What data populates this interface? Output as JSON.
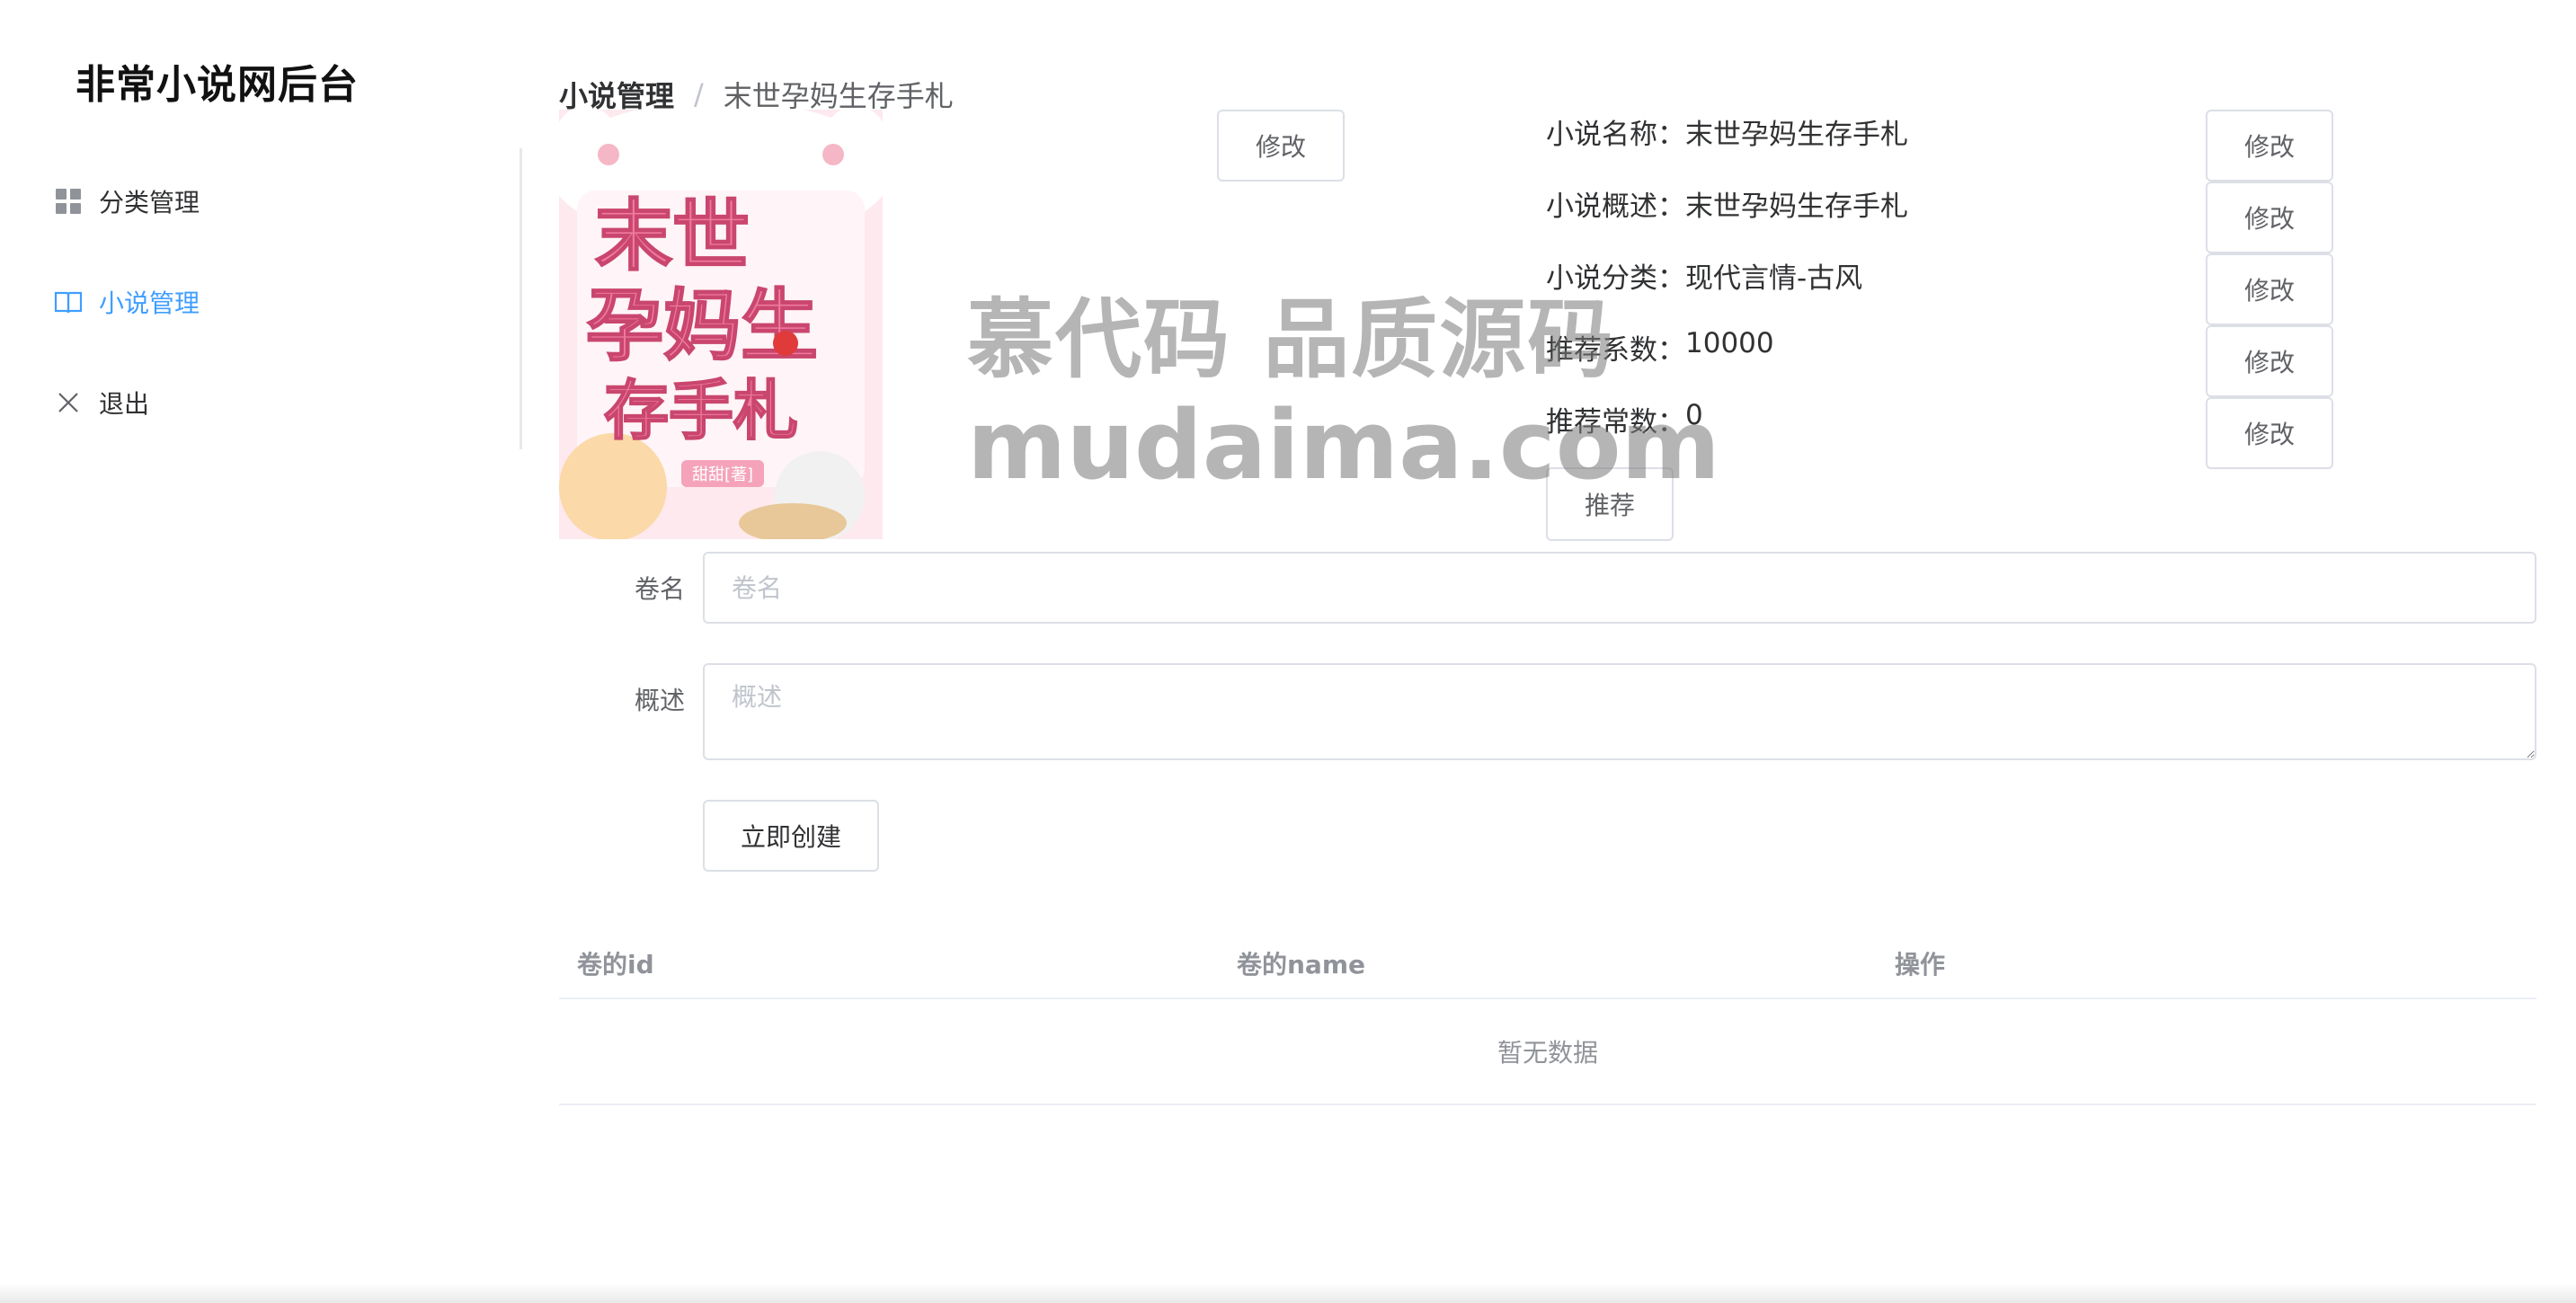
{
  "app": {
    "title": "非常小说网后台"
  },
  "sidebar": {
    "items": [
      {
        "label": "分类管理",
        "icon": "grid-icon",
        "active": false
      },
      {
        "label": "小说管理",
        "icon": "book-open-icon",
        "active": true
      },
      {
        "label": "退出",
        "icon": "close-icon",
        "active": false
      }
    ]
  },
  "breadcrumb": {
    "first": "小说管理",
    "separator": "/",
    "current": "末世孕妈生存手札"
  },
  "cover": {
    "title_line1": "末世",
    "title_line2": "孕妈生",
    "title_line3": "存手札",
    "author": "甜甜[著]"
  },
  "cover_edit_label": "修改",
  "info": {
    "name": {
      "key": "小说名称：",
      "value": "末世孕妈生存手札",
      "button": "修改"
    },
    "summary": {
      "key": "小说概述：",
      "value": "末世孕妈生存手札",
      "button": "修改"
    },
    "category": {
      "key": "小说分类：",
      "value": "现代言情-古风",
      "button": "修改"
    },
    "rec_coef": {
      "key": "推荐系数：",
      "value": "10000",
      "button": "修改"
    },
    "rec_const": {
      "key": "推荐常数：",
      "value": "0",
      "button": "修改"
    },
    "recommend_button": "推荐"
  },
  "form": {
    "volume_label": "卷名",
    "volume_placeholder": "卷名",
    "volume_value": "",
    "desc_label": "概述",
    "desc_placeholder": "概述",
    "desc_value": "",
    "submit_label": "立即创建"
  },
  "table": {
    "columns": [
      "卷的id",
      "卷的name",
      "操作"
    ],
    "empty_text": "暂无数据"
  },
  "watermark": {
    "line1": "慕代码 品质源码",
    "line2": "mudaima.com"
  },
  "colors": {
    "accent": "#409eff",
    "border": "#dcdfe6",
    "muted": "#909399"
  }
}
